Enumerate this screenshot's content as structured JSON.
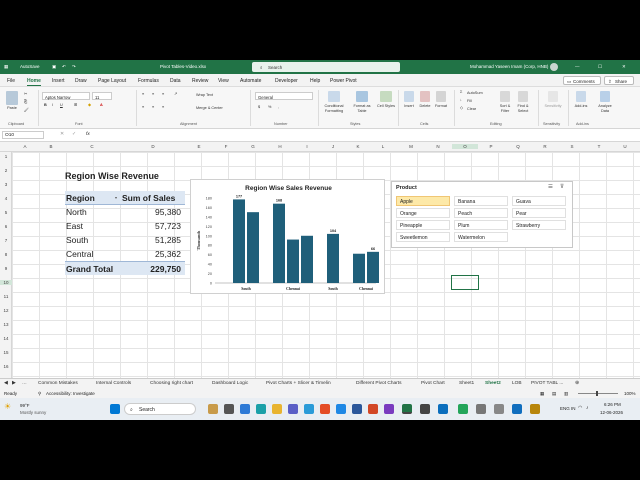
{
  "titlebar": {
    "autosave": "AutoSave",
    "file_name": "Pivot Tables-Video.xlsx",
    "search_placeholder": "Search",
    "user": "Mohammad Yaseen Imam (Corp, HNB)"
  },
  "menu": [
    "File",
    "Home",
    "Insert",
    "Draw",
    "Page Layout",
    "Formulas",
    "Data",
    "Review",
    "View",
    "Automate",
    "Developer",
    "Help",
    "Power Pivot"
  ],
  "menu_active": "Home",
  "menu_right": {
    "comments": "Comments",
    "share": "Share"
  },
  "ribbon": {
    "paste": "Paste",
    "font_name": "Aptos Narrow",
    "font_size": "11",
    "wrap_text": "Wrap Text",
    "merge_center": "Merge & Center",
    "number_format": "General",
    "conditional_formatting": "Conditional Formatting",
    "format_as_table": "Format as Table",
    "cell_styles": "Cell Styles",
    "insert": "Insert",
    "delete": "Delete",
    "format": "Format",
    "autosum": "AutoSum",
    "fill": "Fill",
    "clear": "Clear",
    "sort_filter": "Sort & Filter",
    "find_select": "Find & Select",
    "sensitivity": "Sensitivity",
    "add_ins": "Add-ins",
    "analyze_data": "Analyze Data",
    "groups": [
      "Clipboard",
      "Font",
      "Alignment",
      "Number",
      "Styles",
      "Cells",
      "Editing",
      "Sensitivity",
      "Add-ins"
    ]
  },
  "formula_bar": {
    "name_box": "O10",
    "fx": "fx",
    "value": ""
  },
  "columns": [
    "A",
    "B",
    "C",
    "D",
    "E",
    "F",
    "G",
    "H",
    "I",
    "J",
    "K",
    "L",
    "M",
    "N",
    "O",
    "P",
    "Q",
    "R",
    "S",
    "T",
    "U"
  ],
  "rows": [
    "1",
    "2",
    "3",
    "4",
    "5",
    "6",
    "7",
    "8",
    "9",
    "10",
    "11",
    "12",
    "13",
    "14",
    "15",
    "16"
  ],
  "sheet_title": "Region Wise Revenue",
  "pivot": {
    "header_region": "Region",
    "header_sales": "Sum of Sales",
    "rows": [
      {
        "region": "North",
        "sales": "95,380"
      },
      {
        "region": "East",
        "sales": "57,723"
      },
      {
        "region": "South",
        "sales": "51,285"
      },
      {
        "region": "Central",
        "sales": "25,362"
      }
    ],
    "total_label": "Grand Total",
    "total_value": "229,750"
  },
  "chart_data": {
    "type": "bar",
    "title": "Region Wise Sales Revenue",
    "ylabel": "Thousands",
    "ylim": [
      0,
      180
    ],
    "yticks": [
      0,
      20,
      40,
      60,
      80,
      100,
      120,
      140,
      160,
      180
    ],
    "bars": [
      {
        "value": 177,
        "label": "177"
      },
      {
        "value": 150,
        "label": ""
      },
      {
        "value": 168,
        "label": "168"
      },
      {
        "value": 92,
        "label": ""
      },
      {
        "value": 100,
        "label": ""
      },
      {
        "value": 104,
        "label": "104"
      },
      {
        "value": 62,
        "label": ""
      },
      {
        "value": 66,
        "label": "66"
      }
    ],
    "group_labels": [
      "South",
      "Chennai",
      "South",
      "Chennai"
    ],
    "color": "#1f5f7a"
  },
  "slicer": {
    "title": "Product",
    "items": [
      {
        "label": "Apple",
        "selected": true
      },
      {
        "label": "Banana",
        "selected": false
      },
      {
        "label": "Guava",
        "selected": false
      },
      {
        "label": "Orange",
        "selected": false
      },
      {
        "label": "Peach",
        "selected": false
      },
      {
        "label": "Pear",
        "selected": false
      },
      {
        "label": "Pineapple",
        "selected": false
      },
      {
        "label": "Plum",
        "selected": false
      },
      {
        "label": "Strawberry",
        "selected": false
      },
      {
        "label": "Sweetlemon",
        "selected": false
      },
      {
        "label": "Watermelon",
        "selected": false
      }
    ]
  },
  "sheet_tabs": [
    "Common Mistakes",
    "Internal Controls",
    "Choosing right chart",
    "Dashboard Logic",
    "Pivot Charts + Slicer & Timelin",
    "Different Pivot Charts",
    "Pivot Chart",
    "Sheet1",
    "Sheet2",
    "LOB",
    "PIVOT TABL ..."
  ],
  "active_sheet": "Sheet2",
  "status": {
    "ready": "Ready",
    "accessibility": "Accessibility: Investigate",
    "zoom": "100%"
  },
  "taskbar": {
    "weather_temp": "99°F",
    "weather_desc": "Mostly sunny",
    "search": "Search",
    "time": "6:26 PM",
    "date": "12-06-2026",
    "lang": "ENG IN"
  }
}
